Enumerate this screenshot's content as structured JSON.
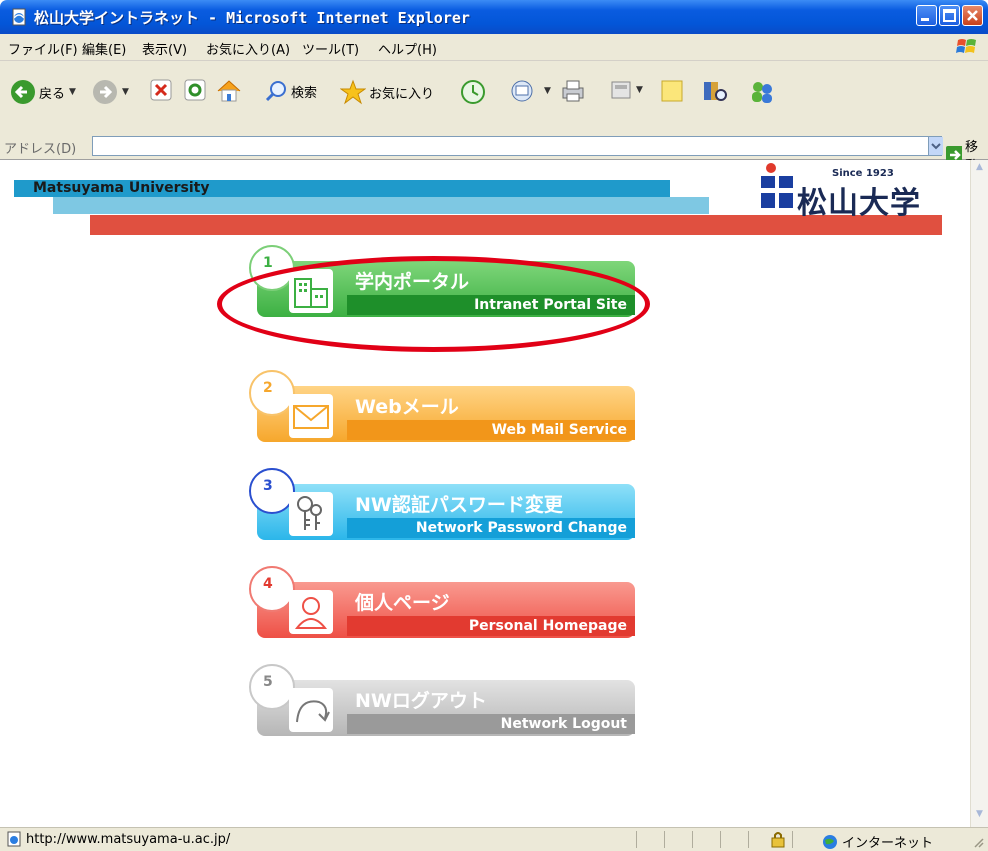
{
  "window": {
    "title": "松山大学イントラネット - Microsoft Internet Explorer"
  },
  "menubar": {
    "items": [
      "ファイル(F)",
      "編集(E)",
      "表示(V)",
      "お気に入り(A)",
      "ツール(T)",
      "ヘルプ(H)"
    ]
  },
  "toolbar": {
    "back_label": "戻る",
    "search_label": "検索",
    "favorites_label": "お気に入り"
  },
  "addressbar": {
    "label": "アドレス(D)",
    "value": "",
    "go_label": "移動"
  },
  "page": {
    "site_name": "Matsuyama University",
    "logo_since": "Since 1923",
    "logo_text": "松山大学",
    "buttons": [
      {
        "number": "1",
        "title": "学内ポータル",
        "subtitle": "Intranet Portal Site",
        "color": "#3cb043",
        "icon": "building-icon"
      },
      {
        "number": "2",
        "title": "Webメール",
        "subtitle": "Web Mail Service",
        "color": "#f6a72c",
        "icon": "envelope-icon"
      },
      {
        "number": "3",
        "title": "NW認証パスワード変更",
        "subtitle": "Network Password Change",
        "color": "#2bb6ea",
        "icon": "keys-icon"
      },
      {
        "number": "4",
        "title": "個人ページ",
        "subtitle": "Personal Homepage",
        "color": "#ee5046",
        "icon": "person-icon"
      },
      {
        "number": "5",
        "title": "NWログアウト",
        "subtitle": "Network Logout",
        "color": "#b0b0b0",
        "icon": "logout-arrow-icon"
      }
    ]
  },
  "statusbar": {
    "url": "http://www.matsuyama-u.ac.jp/",
    "zone": "インターネット"
  },
  "colors": {
    "title_bar": "#0a5ce0",
    "stripe_blue": "#1f9acb",
    "stripe_light_blue": "#7ec8e3",
    "stripe_red": "#e05040",
    "highlight_ellipse": "#e10016"
  }
}
